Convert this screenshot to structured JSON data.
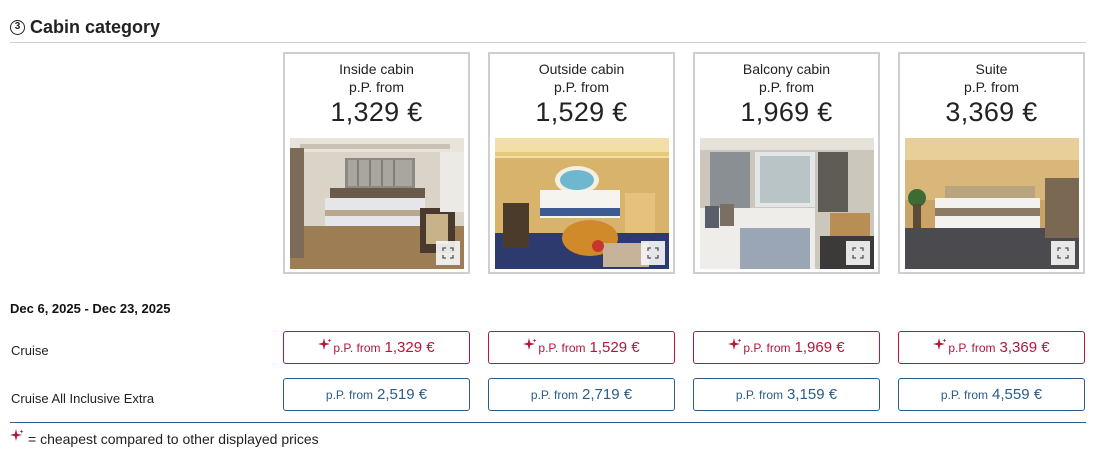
{
  "header": {
    "step": "3",
    "title": "Cabin category"
  },
  "cabins": [
    {
      "name": "Inside cabin",
      "pp": "p.P. from",
      "price": "1,329 €"
    },
    {
      "name": "Outside cabin",
      "pp": "p.P. from",
      "price": "1,529 €"
    },
    {
      "name": "Balcony cabin",
      "pp": "p.P. from",
      "price": "1,969 €"
    },
    {
      "name": "Suite",
      "pp": "p.P. from",
      "price": "3,369 €"
    }
  ],
  "dates": "Dec 6, 2025 - Dec 23, 2025",
  "rows": [
    {
      "label": "Cruise",
      "prefix": "p.P. from",
      "prices": [
        "1,329 €",
        "1,529 €",
        "1,969 €",
        "3,369 €"
      ]
    },
    {
      "label": "Cruise All Inclusive Extra",
      "prefix": "p.P. from",
      "prices": [
        "2,519 €",
        "2,719 €",
        "3,159 €",
        "4,559 €"
      ]
    }
  ],
  "legend": "= cheapest compared to other displayed prices",
  "colors": {
    "cheapest": "#b5163c",
    "standard": "#2b5b86"
  },
  "icons": {
    "expand": "expand-icon",
    "cheapest": "sparkle-icon"
  }
}
